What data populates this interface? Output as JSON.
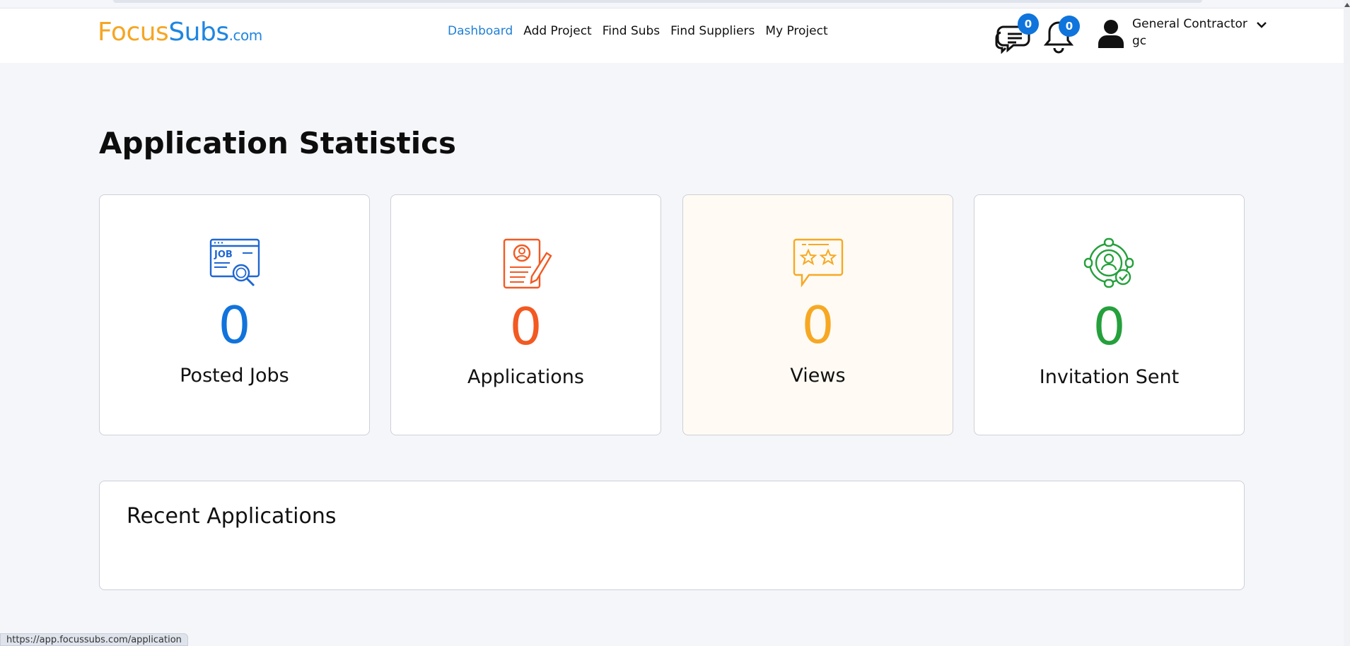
{
  "brand": {
    "part1": "Focus",
    "part2": "Subs",
    "part3": ".com"
  },
  "nav": {
    "items": [
      {
        "label": "Dashboard",
        "active": true
      },
      {
        "label": "Add Project",
        "active": false
      },
      {
        "label": "Find Subs",
        "active": false
      },
      {
        "label": "Find Suppliers",
        "active": false
      },
      {
        "label": "My Project",
        "active": false
      }
    ],
    "messages_badge": "0",
    "notifications_badge": "0"
  },
  "user": {
    "name": "General Contractor",
    "role": "gc"
  },
  "page": {
    "title": "Application Statistics"
  },
  "stats": [
    {
      "label": "Posted Jobs",
      "value": "0",
      "color": "#1173dc",
      "icon": "job-search-icon"
    },
    {
      "label": "Applications",
      "value": "0",
      "color": "#f25a22",
      "icon": "resume-pencil-icon"
    },
    {
      "label": "Views",
      "value": "0",
      "color": "#f7a823",
      "icon": "star-review-icon"
    },
    {
      "label": "Invitation Sent",
      "value": "0",
      "color": "#25a03c",
      "icon": "target-user-icon"
    }
  ],
  "recent": {
    "title": "Recent Applications"
  },
  "status_bar": {
    "url": "https://app.focussubs.com/application"
  },
  "colors": {
    "accent": "#1f7fd6",
    "badge": "#0f74db",
    "brand_orange": "#f5a623",
    "brand_blue": "#1f86e0"
  }
}
